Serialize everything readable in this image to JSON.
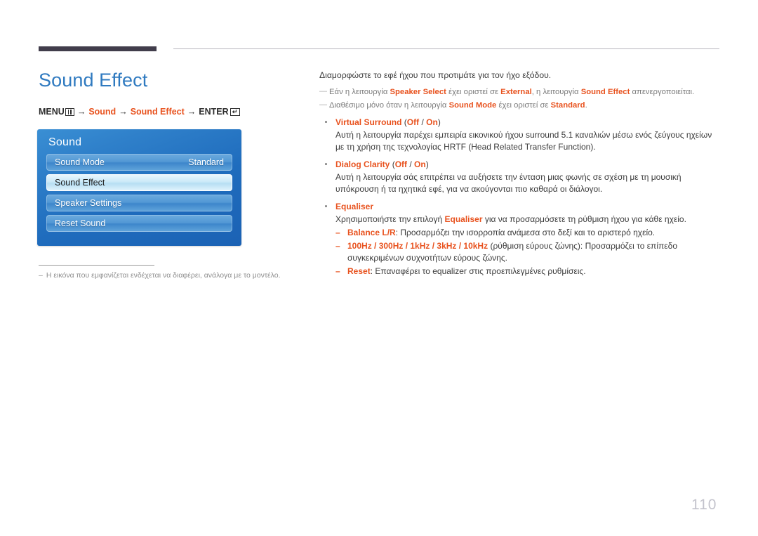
{
  "page_title": "Sound Effect",
  "menu_path": {
    "menu_label": "MENU",
    "menu_icon": "menu-bars-icon",
    "arrow": "→",
    "step1": "Sound",
    "step2": "Sound Effect",
    "enter_label": "ENTER",
    "enter_icon": "enter-return-icon",
    "enter_glyph": "↵"
  },
  "osd": {
    "title": "Sound",
    "rows": [
      {
        "label": "Sound Mode",
        "value": "Standard",
        "selected": false
      },
      {
        "label": "Sound Effect",
        "value": "",
        "selected": true
      },
      {
        "label": "Speaker Settings",
        "value": "",
        "selected": false
      },
      {
        "label": "Reset Sound",
        "value": "",
        "selected": false
      }
    ]
  },
  "figure_note": {
    "dash": "–",
    "text": "Η εικόνα που εμφανίζεται ενδέχεται να διαφέρει, ανάλογα με το μοντέλο."
  },
  "content": {
    "intro": "Διαμορφώστε το εφέ ήχου που προτιμάτε για τον ήχο εξόδου.",
    "note_marker": "—",
    "note1": {
      "p1": "Εάν η λειτουργία ",
      "b1": "Speaker Select",
      "p2": " έχει οριστεί σε ",
      "b2": "External",
      "p3": ", η λειτουργία ",
      "b3": "Sound Effect",
      "p4": " απενεργοποιείται."
    },
    "note2": {
      "p1": "Διαθέσιμο μόνο όταν η λειτουργία ",
      "b1": "Sound Mode",
      "p2": " έχει οριστεί σε ",
      "b2": "Standard",
      "p3": "."
    },
    "bullets": [
      {
        "title": "Virtual Surround",
        "options_open": " (",
        "opt1": "Off",
        "opt_sep": " / ",
        "opt2": "On",
        "options_close": ")",
        "body": "Αυτή η λειτουργία παρέχει εμπειρία εικονικού ήχου surround 5.1 καναλιών μέσω ενός ζεύγους ηχείων με τη χρήση της τεχνολογίας HRTF (Head Related Transfer Function)."
      },
      {
        "title": "Dialog Clarity",
        "options_open": " (",
        "opt1": "Off",
        "opt_sep": " / ",
        "opt2": "On",
        "options_close": ")",
        "body": "Αυτή η λειτουργία σάς επιτρέπει να αυξήσετε την ένταση μιας φωνής σε σχέση με τη μουσική υπόκρουση ή τα ηχητικά εφέ, για να ακούγονται πιο καθαρά οι διάλογοι."
      }
    ],
    "equaliser": {
      "title": "Equaliser",
      "body_p1": "Χρησιμοποιήστε την επιλογή ",
      "body_b1": "Equaliser",
      "body_p2": " για να προσαρμόσετε τη ρύθμιση ήχου για κάθε ηχείο.",
      "sub_dash": "–",
      "sub_items": [
        {
          "term": "Balance L/R",
          "text": ": Προσαρμόζει την ισορροπία ανάμεσα στο δεξί και το αριστερό ηχείο."
        },
        {
          "term": "100Hz / 300Hz / 1kHz / 3kHz / 10kHz",
          "text": " (ρύθμιση εύρους ζώνης): Προσαρμόζει το επίπεδο συγκεκριμένων συχνοτήτων εύρους ζώνης."
        },
        {
          "term": "Reset",
          "text": ": Επαναφέρει το equalizer στις προεπιλεγμένες ρυθμίσεις."
        }
      ]
    }
  },
  "page_number": "110"
}
